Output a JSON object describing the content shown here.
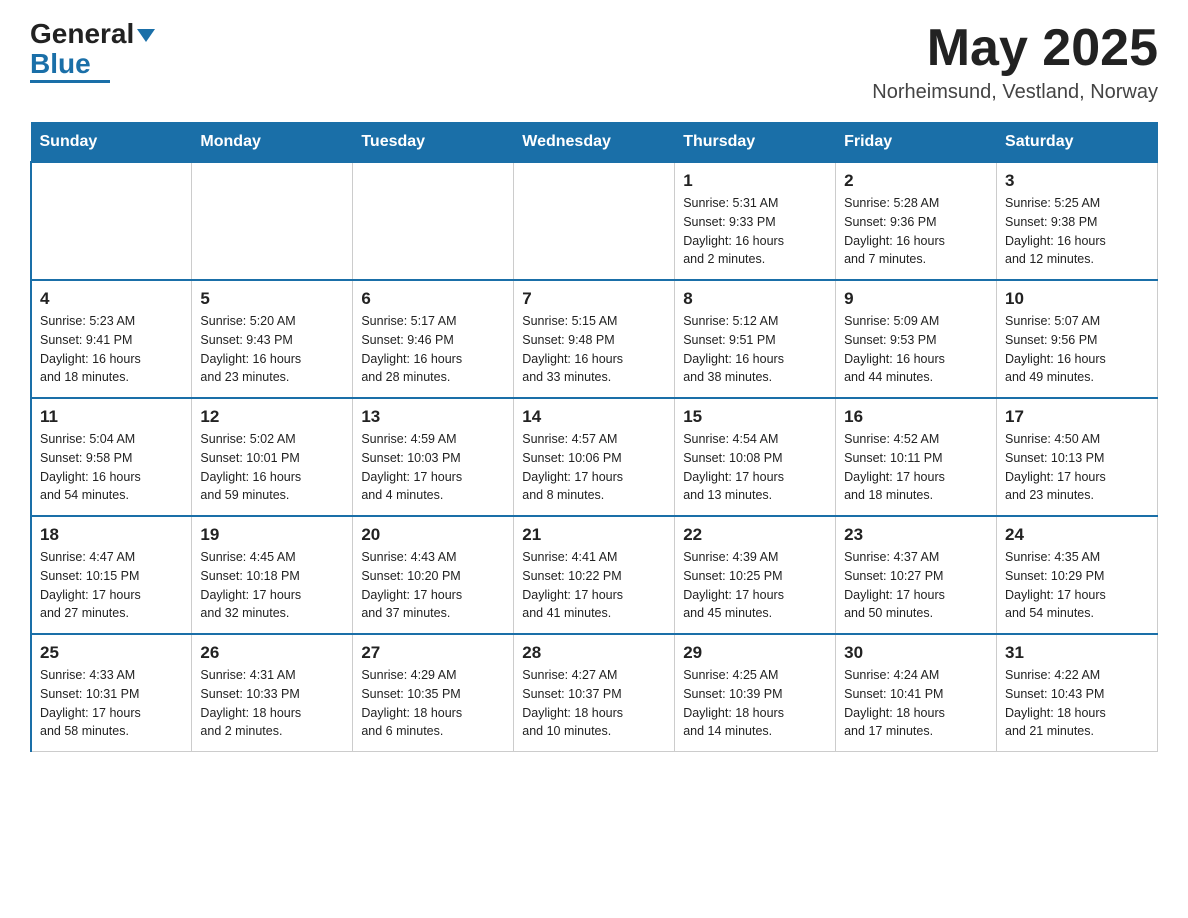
{
  "logo": {
    "text_general": "General",
    "text_blue": "Blue",
    "line": true
  },
  "header": {
    "month_title": "May 2025",
    "location": "Norheimsund, Vestland, Norway"
  },
  "days_of_week": [
    "Sunday",
    "Monday",
    "Tuesday",
    "Wednesday",
    "Thursday",
    "Friday",
    "Saturday"
  ],
  "weeks": [
    {
      "days": [
        {
          "num": "",
          "info": ""
        },
        {
          "num": "",
          "info": ""
        },
        {
          "num": "",
          "info": ""
        },
        {
          "num": "",
          "info": ""
        },
        {
          "num": "1",
          "info": "Sunrise: 5:31 AM\nSunset: 9:33 PM\nDaylight: 16 hours\nand 2 minutes."
        },
        {
          "num": "2",
          "info": "Sunrise: 5:28 AM\nSunset: 9:36 PM\nDaylight: 16 hours\nand 7 minutes."
        },
        {
          "num": "3",
          "info": "Sunrise: 5:25 AM\nSunset: 9:38 PM\nDaylight: 16 hours\nand 12 minutes."
        }
      ]
    },
    {
      "days": [
        {
          "num": "4",
          "info": "Sunrise: 5:23 AM\nSunset: 9:41 PM\nDaylight: 16 hours\nand 18 minutes."
        },
        {
          "num": "5",
          "info": "Sunrise: 5:20 AM\nSunset: 9:43 PM\nDaylight: 16 hours\nand 23 minutes."
        },
        {
          "num": "6",
          "info": "Sunrise: 5:17 AM\nSunset: 9:46 PM\nDaylight: 16 hours\nand 28 minutes."
        },
        {
          "num": "7",
          "info": "Sunrise: 5:15 AM\nSunset: 9:48 PM\nDaylight: 16 hours\nand 33 minutes."
        },
        {
          "num": "8",
          "info": "Sunrise: 5:12 AM\nSunset: 9:51 PM\nDaylight: 16 hours\nand 38 minutes."
        },
        {
          "num": "9",
          "info": "Sunrise: 5:09 AM\nSunset: 9:53 PM\nDaylight: 16 hours\nand 44 minutes."
        },
        {
          "num": "10",
          "info": "Sunrise: 5:07 AM\nSunset: 9:56 PM\nDaylight: 16 hours\nand 49 minutes."
        }
      ]
    },
    {
      "days": [
        {
          "num": "11",
          "info": "Sunrise: 5:04 AM\nSunset: 9:58 PM\nDaylight: 16 hours\nand 54 minutes."
        },
        {
          "num": "12",
          "info": "Sunrise: 5:02 AM\nSunset: 10:01 PM\nDaylight: 16 hours\nand 59 minutes."
        },
        {
          "num": "13",
          "info": "Sunrise: 4:59 AM\nSunset: 10:03 PM\nDaylight: 17 hours\nand 4 minutes."
        },
        {
          "num": "14",
          "info": "Sunrise: 4:57 AM\nSunset: 10:06 PM\nDaylight: 17 hours\nand 8 minutes."
        },
        {
          "num": "15",
          "info": "Sunrise: 4:54 AM\nSunset: 10:08 PM\nDaylight: 17 hours\nand 13 minutes."
        },
        {
          "num": "16",
          "info": "Sunrise: 4:52 AM\nSunset: 10:11 PM\nDaylight: 17 hours\nand 18 minutes."
        },
        {
          "num": "17",
          "info": "Sunrise: 4:50 AM\nSunset: 10:13 PM\nDaylight: 17 hours\nand 23 minutes."
        }
      ]
    },
    {
      "days": [
        {
          "num": "18",
          "info": "Sunrise: 4:47 AM\nSunset: 10:15 PM\nDaylight: 17 hours\nand 27 minutes."
        },
        {
          "num": "19",
          "info": "Sunrise: 4:45 AM\nSunset: 10:18 PM\nDaylight: 17 hours\nand 32 minutes."
        },
        {
          "num": "20",
          "info": "Sunrise: 4:43 AM\nSunset: 10:20 PM\nDaylight: 17 hours\nand 37 minutes."
        },
        {
          "num": "21",
          "info": "Sunrise: 4:41 AM\nSunset: 10:22 PM\nDaylight: 17 hours\nand 41 minutes."
        },
        {
          "num": "22",
          "info": "Sunrise: 4:39 AM\nSunset: 10:25 PM\nDaylight: 17 hours\nand 45 minutes."
        },
        {
          "num": "23",
          "info": "Sunrise: 4:37 AM\nSunset: 10:27 PM\nDaylight: 17 hours\nand 50 minutes."
        },
        {
          "num": "24",
          "info": "Sunrise: 4:35 AM\nSunset: 10:29 PM\nDaylight: 17 hours\nand 54 minutes."
        }
      ]
    },
    {
      "days": [
        {
          "num": "25",
          "info": "Sunrise: 4:33 AM\nSunset: 10:31 PM\nDaylight: 17 hours\nand 58 minutes."
        },
        {
          "num": "26",
          "info": "Sunrise: 4:31 AM\nSunset: 10:33 PM\nDaylight: 18 hours\nand 2 minutes."
        },
        {
          "num": "27",
          "info": "Sunrise: 4:29 AM\nSunset: 10:35 PM\nDaylight: 18 hours\nand 6 minutes."
        },
        {
          "num": "28",
          "info": "Sunrise: 4:27 AM\nSunset: 10:37 PM\nDaylight: 18 hours\nand 10 minutes."
        },
        {
          "num": "29",
          "info": "Sunrise: 4:25 AM\nSunset: 10:39 PM\nDaylight: 18 hours\nand 14 minutes."
        },
        {
          "num": "30",
          "info": "Sunrise: 4:24 AM\nSunset: 10:41 PM\nDaylight: 18 hours\nand 17 minutes."
        },
        {
          "num": "31",
          "info": "Sunrise: 4:22 AM\nSunset: 10:43 PM\nDaylight: 18 hours\nand 21 minutes."
        }
      ]
    }
  ]
}
